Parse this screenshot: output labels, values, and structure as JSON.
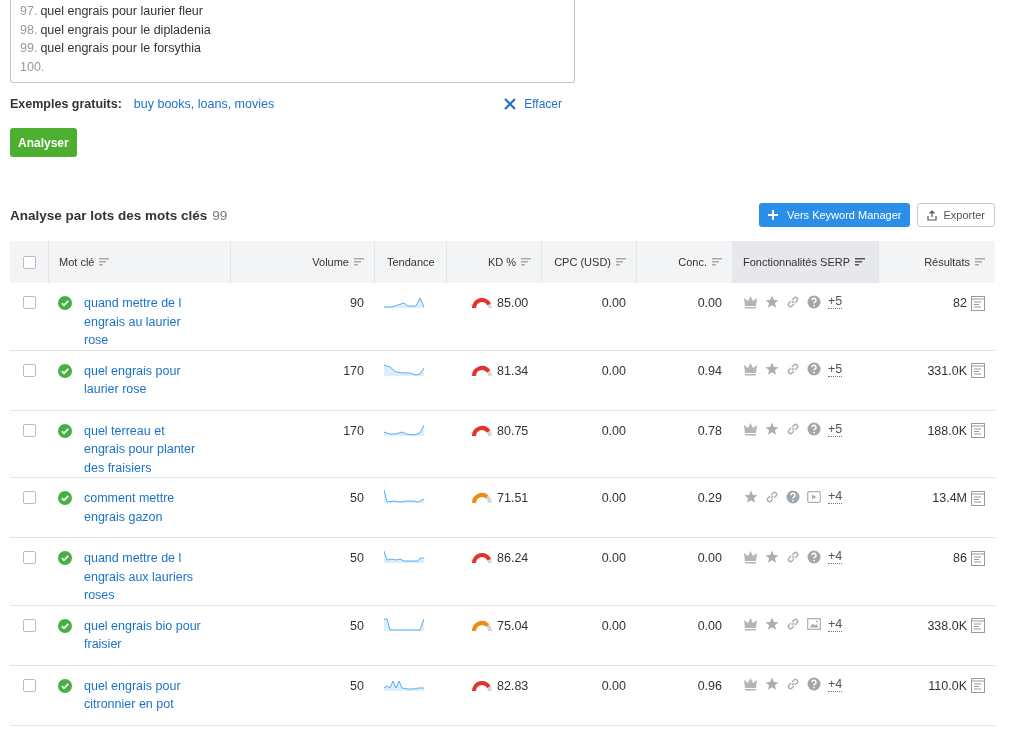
{
  "keyword_input": {
    "lines": [
      {
        "number": "97.",
        "text": "quel engrais pour laurier fleur"
      },
      {
        "number": "98.",
        "text": "quel engrais pour le dipladenia"
      },
      {
        "number": "99.",
        "text": "quel engrais pour le forsythia"
      },
      {
        "number": "100."
      }
    ]
  },
  "examples": {
    "label": "Exemples gratuits:",
    "link": "buy books, loans, movies"
  },
  "clear_button": "Effacer",
  "analyze_button": "Analyser",
  "results": {
    "title": "Analyse par lots des mots clés",
    "count": "99",
    "keyword_manager_button": "Vers Keyword Manager",
    "export_button": "Exporter"
  },
  "table": {
    "select_all_checked": false,
    "columns": [
      {
        "label": "Mot clé",
        "sortable": true,
        "sorted": false
      },
      {
        "label": "Volume",
        "sortable": true,
        "sorted": false
      },
      {
        "label": "Tendance",
        "sortable": false,
        "sorted": false
      },
      {
        "label": "KD %",
        "sortable": true,
        "sorted": false
      },
      {
        "label": "CPC (USD)",
        "sortable": true,
        "sorted": false
      },
      {
        "label": "Conc.",
        "sortable": true,
        "sorted": false
      },
      {
        "label": "Fonctionnalités SERP",
        "sortable": true,
        "sorted": true
      },
      {
        "label": "Résultats",
        "sortable": true,
        "sorted": false
      }
    ],
    "rows": [
      {
        "checked": false,
        "keyword": "quand mettre de l engrais au laurier rose",
        "volume": "90",
        "kd": "85.00",
        "level": 0.85,
        "color": "#e8312f",
        "cpc": "0.00",
        "conc": "0.00",
        "serp": [
          {
            "kind": "crown"
          },
          {
            "kind": "star"
          },
          {
            "kind": "link"
          },
          {
            "kind": "question"
          }
        ],
        "more": "+5",
        "results": "82"
      },
      {
        "checked": false,
        "keyword": "quel engrais pour laurier rose",
        "volume": "170",
        "kd": "81.34",
        "level": 0.81,
        "color": "#e8312f",
        "cpc": "0.00",
        "conc": "0.94",
        "serp": [
          {
            "kind": "crown"
          },
          {
            "kind": "star"
          },
          {
            "kind": "link"
          },
          {
            "kind": "question"
          }
        ],
        "more": "+5",
        "results": "331.0K"
      },
      {
        "checked": false,
        "keyword": "quel terreau et engrais pour planter des fraisiers",
        "volume": "170",
        "kd": "80.75",
        "level": 0.81,
        "color": "#e8312f",
        "cpc": "0.00",
        "conc": "0.78",
        "serp": [
          {
            "kind": "crown"
          },
          {
            "kind": "star"
          },
          {
            "kind": "link"
          },
          {
            "kind": "question"
          }
        ],
        "more": "+5",
        "results": "188.0K"
      },
      {
        "checked": false,
        "keyword": "comment mettre engrais gazon",
        "volume": "50",
        "kd": "71.51",
        "level": 0.72,
        "color": "#f28c0f",
        "cpc": "0.00",
        "conc": "0.29",
        "serp": [
          {
            "kind": "star"
          },
          {
            "kind": "link"
          },
          {
            "kind": "question"
          },
          {
            "kind": "video"
          }
        ],
        "more": "+4",
        "results": "13.4M"
      },
      {
        "checked": false,
        "keyword": "quand mettre de l engrais aux lauriers roses",
        "volume": "50",
        "kd": "86.24",
        "level": 0.86,
        "color": "#e8312f",
        "cpc": "0.00",
        "conc": "0.00",
        "serp": [
          {
            "kind": "crown"
          },
          {
            "kind": "star"
          },
          {
            "kind": "link"
          },
          {
            "kind": "question"
          }
        ],
        "more": "+4",
        "results": "86"
      },
      {
        "checked": false,
        "keyword": "quel engrais bio pour fraisier",
        "volume": "50",
        "kd": "75.04",
        "level": 0.75,
        "color": "#f28c0f",
        "cpc": "0.00",
        "conc": "0.00",
        "serp": [
          {
            "kind": "crown"
          },
          {
            "kind": "star"
          },
          {
            "kind": "link"
          },
          {
            "kind": "image"
          }
        ],
        "more": "+4",
        "results": "338.0K"
      },
      {
        "checked": false,
        "keyword": "quel engrais pour citronnier en pot",
        "volume": "50",
        "kd": "82.83",
        "level": 0.83,
        "color": "#e8312f",
        "cpc": "0.00",
        "conc": "0.96",
        "serp": [
          {
            "kind": "crown"
          },
          {
            "kind": "star"
          },
          {
            "kind": "link"
          },
          {
            "kind": "question"
          }
        ],
        "more": "+4",
        "results": "110.0K"
      }
    ]
  }
}
